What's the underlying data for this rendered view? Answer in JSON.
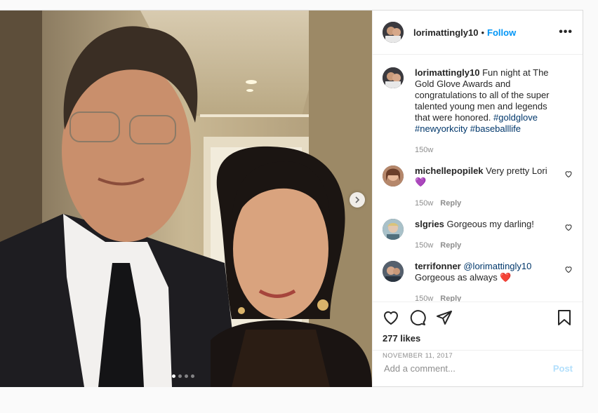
{
  "colors": {
    "link": "#0095f6",
    "hashtag": "#00376b",
    "meta": "#8e8e8e",
    "heart_red": "#ed4956",
    "purple_heart": "#a855f7"
  },
  "header": {
    "username": "lorimattingly10",
    "separator": "•",
    "follow_label": "Follow",
    "more_label": "•••"
  },
  "caption": {
    "username": "lorimattingly10",
    "text": "Fun night at The Gold Glove Awards and congratulations to all of the super talented young men and legends that were honored.",
    "hashtags": "#goldglove #newyorkcity #baseballlife",
    "age": "150w"
  },
  "comments": [
    {
      "username": "michellepopilek",
      "text": "Very pretty Lori",
      "emoji": "💜",
      "age": "150w",
      "reply_label": "Reply"
    },
    {
      "username": "slgries",
      "text": "Gorgeous my darling!",
      "age": "150w",
      "reply_label": "Reply"
    },
    {
      "username": "terrifonner",
      "mention": "@lorimattingly10",
      "text": "Gorgeous as always",
      "emoji": "❤️",
      "age": "150w",
      "reply_label": "Reply"
    }
  ],
  "actions": {
    "icons": [
      "heart-icon",
      "comment-icon",
      "share-icon",
      "bookmark-icon"
    ]
  },
  "likes": "277 likes",
  "date": "NOVEMBER 11, 2017",
  "add_comment": {
    "placeholder": "Add a comment...",
    "post_label": "Post"
  },
  "carousel": {
    "slide_count": 4,
    "active_index": 0,
    "next_icon": "chevron-right-icon"
  }
}
